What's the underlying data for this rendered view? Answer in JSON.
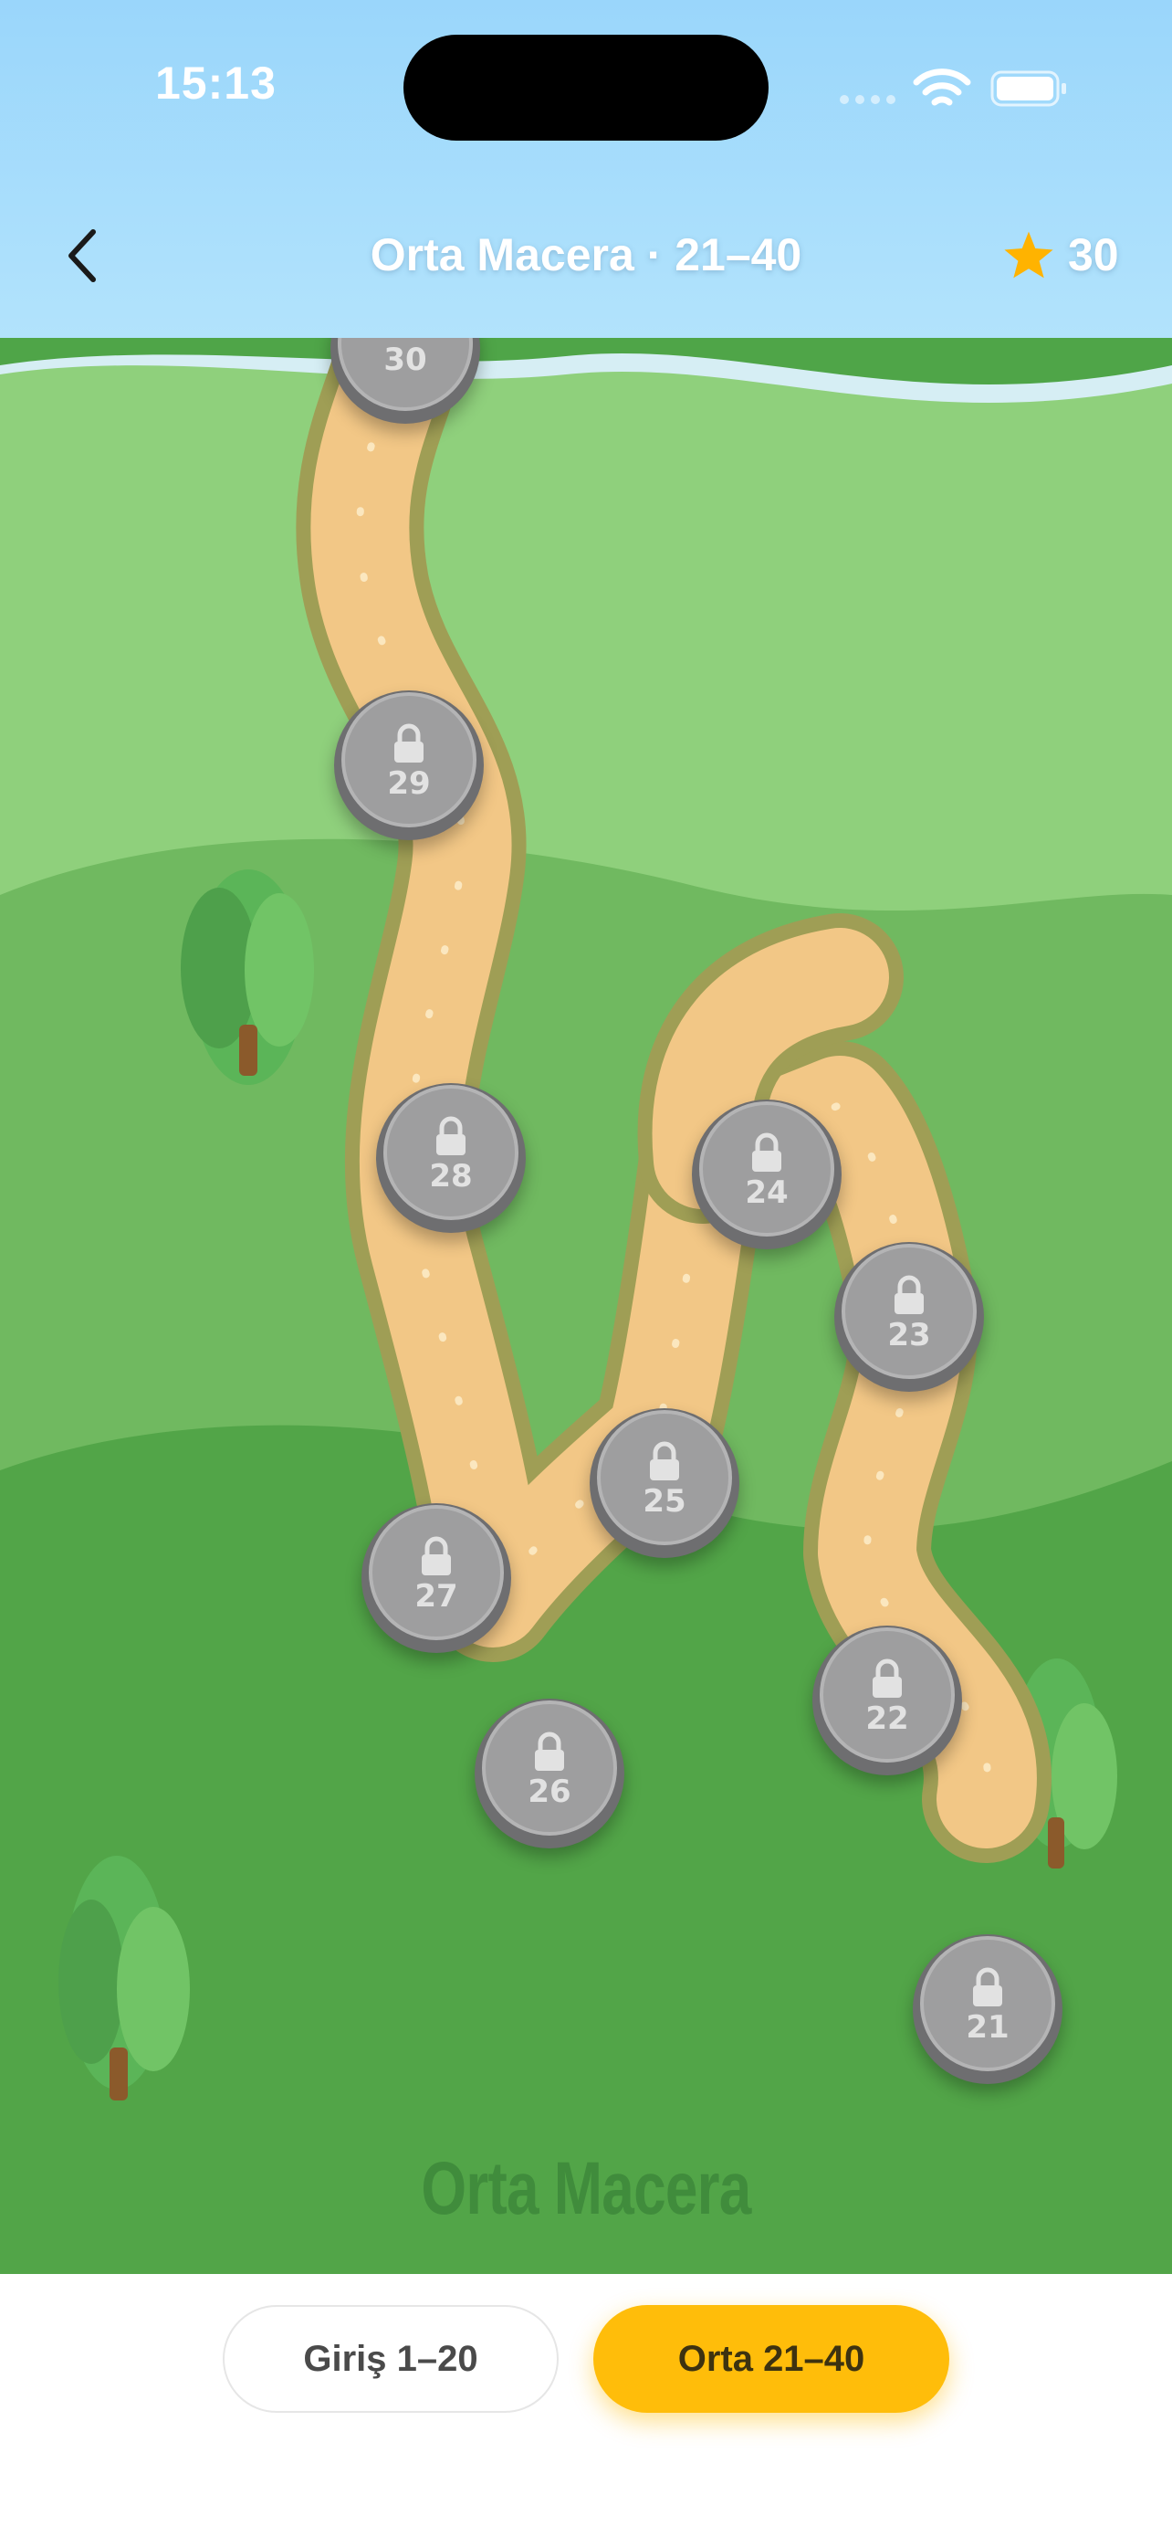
{
  "status_bar": {
    "time": "15:13"
  },
  "header": {
    "title": "Orta Macera · 21–40",
    "star_count": "30"
  },
  "map": {
    "label": "Orta Macera",
    "levels": [
      {
        "number": "21",
        "locked": true
      },
      {
        "number": "22",
        "locked": true
      },
      {
        "number": "23",
        "locked": true
      },
      {
        "number": "24",
        "locked": true
      },
      {
        "number": "25",
        "locked": true
      },
      {
        "number": "26",
        "locked": true
      },
      {
        "number": "27",
        "locked": true
      },
      {
        "number": "28",
        "locked": true
      },
      {
        "number": "29",
        "locked": true
      },
      {
        "number": "30",
        "locked": true
      }
    ]
  },
  "tabs": [
    {
      "label": "Giriş  1–20",
      "active": false
    },
    {
      "label": "Orta  21–40",
      "active": true
    }
  ],
  "colors": {
    "accent": "#ffbd0a",
    "star": "#ffb300",
    "node": "#9e9e9f",
    "path": "#f5c98c"
  },
  "icons": {
    "back": "chevron-left-icon",
    "star": "star-icon",
    "lock": "lock-icon"
  }
}
